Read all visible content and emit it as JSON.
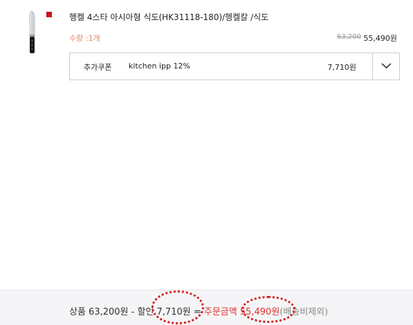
{
  "product": {
    "title": "헹켈 4스타 아시아형 식도(HK31118-180)/헹켈칼 /식도",
    "quantity": "수량 :1개",
    "original_price": "63,200",
    "sale_price": "55,490원"
  },
  "coupon": {
    "label": "추가쿠폰",
    "name": "kitchen ipp 12%",
    "amount": "7,710원"
  },
  "summary": {
    "product_label": "상품 63,200원 - ",
    "discount_label": "할인 7,710원 = ",
    "order_label": "주문금액 ",
    "order_amount": "55,490원",
    "note": "(배송비제외)"
  },
  "colors": {
    "accent": "#e0302a",
    "qty": "#e08a5a",
    "ring": "#d51f1f"
  }
}
